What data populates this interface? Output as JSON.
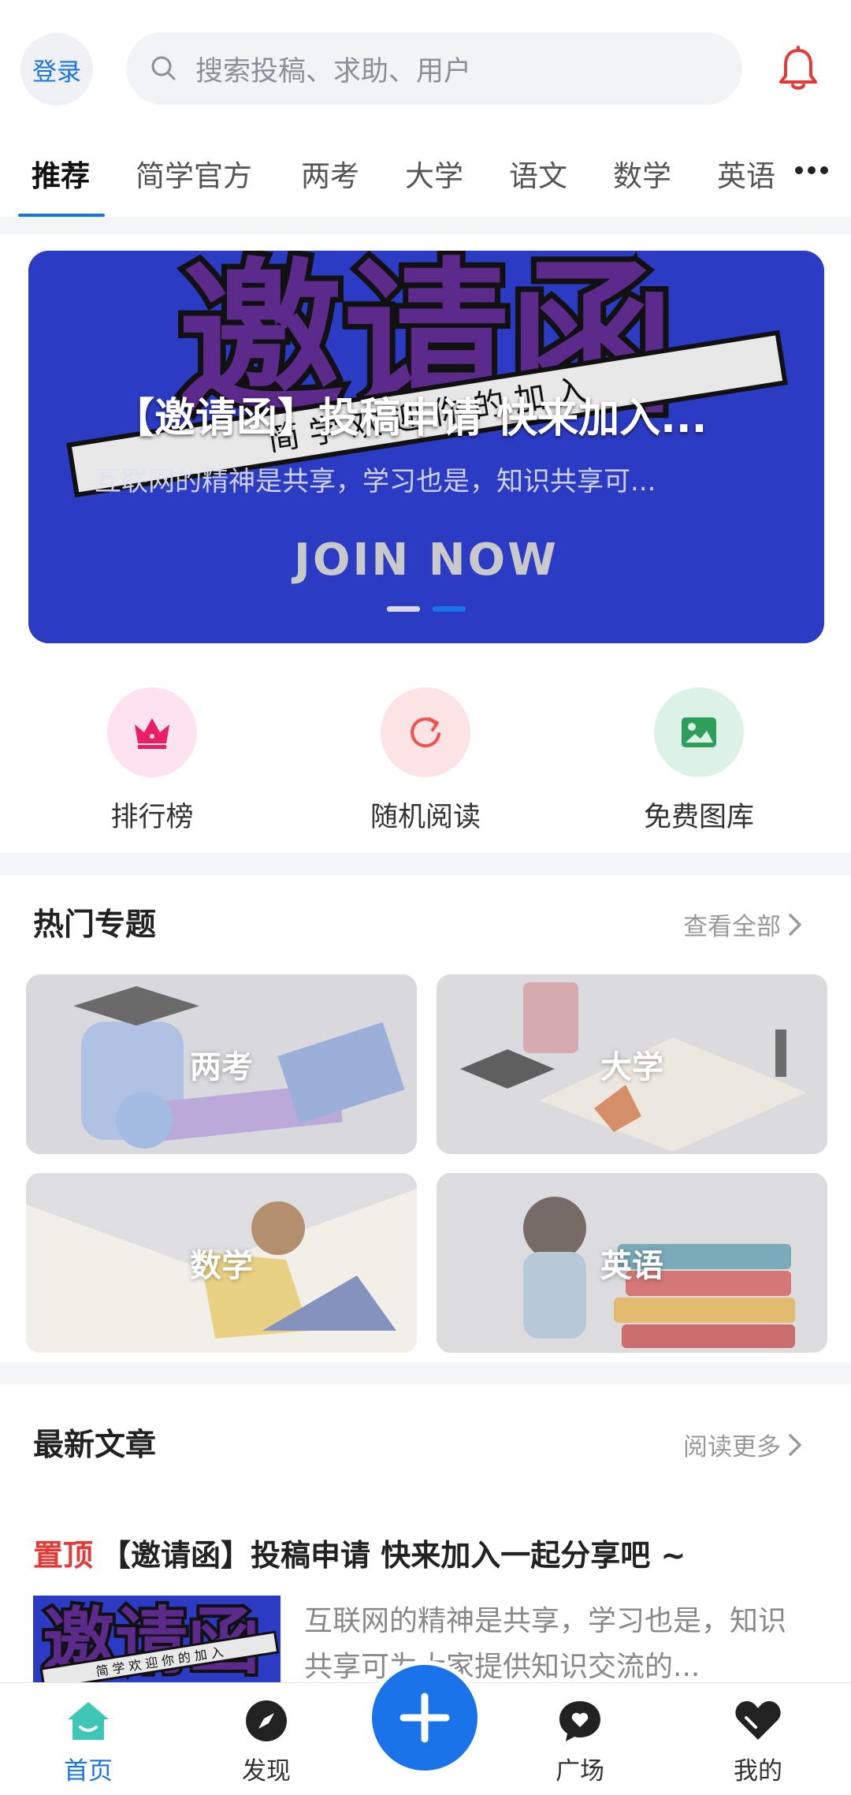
{
  "header": {
    "login_label": "登录",
    "search_placeholder": "搜索投稿、求助、用户",
    "bell_icon": "bell-icon"
  },
  "tabs": [
    {
      "label": "推荐",
      "active": true
    },
    {
      "label": "简学官方"
    },
    {
      "label": "两考"
    },
    {
      "label": "大学"
    },
    {
      "label": "语文"
    },
    {
      "label": "数学"
    },
    {
      "label": "英语"
    }
  ],
  "banner": {
    "title": "【邀请函】投稿申请 快来加入...",
    "subtitle": "互联网的精神是共享，学习也是，知识共享可...",
    "art_heading": "邀请函",
    "art_ribbon": "简 学 欢 迎 你 的 加 入",
    "join_text": "JOIN NOW",
    "slide_count": 2,
    "active_slide": 2
  },
  "quick_entries": [
    {
      "label": "排行榜",
      "icon": "crown-icon",
      "bg": "#fde3ef",
      "color": "#e91e63"
    },
    {
      "label": "随机阅读",
      "icon": "refresh-icon",
      "bg": "#fde4e4",
      "color": "#ef5350"
    },
    {
      "label": "免费图库",
      "icon": "image-icon",
      "bg": "#ddf2e6",
      "color": "#2e9e5b"
    }
  ],
  "hot_topics": {
    "title": "热门专题",
    "more": "查看全部",
    "items": [
      {
        "label": "两考"
      },
      {
        "label": "大学"
      },
      {
        "label": "数学"
      },
      {
        "label": "英语"
      }
    ]
  },
  "latest": {
    "title": "最新文章",
    "more": "阅读更多",
    "article": {
      "pin": "置顶",
      "title": "【邀请函】投稿申请 快来加入一起分享吧 ~",
      "excerpt": "互联网的精神是共享，学习也是，知识共享可为大家提供知识交流的...",
      "thumb_heading": "邀请函",
      "thumb_ribbon": "简 学 欢 迎 你 的 加 入"
    }
  },
  "bottom_nav": [
    {
      "label": "首页",
      "icon": "home-icon",
      "active": true
    },
    {
      "label": "发现",
      "icon": "compass-icon"
    },
    {
      "label": "广场",
      "icon": "chat-icon"
    },
    {
      "label": "我的",
      "icon": "heart-icon"
    }
  ],
  "fab_icon": "plus-icon",
  "colors": {
    "accent": "#1a73e8",
    "banner_bg": "#2c3bc4",
    "pin_red": "#e53935"
  }
}
